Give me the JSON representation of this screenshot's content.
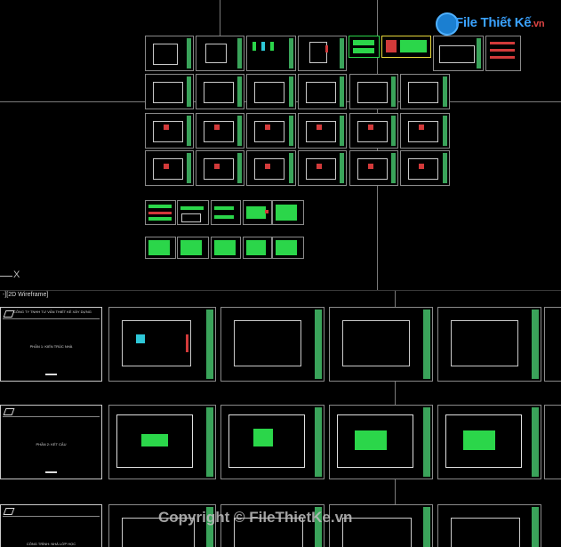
{
  "viewport_label": "-][2D Wireframe]",
  "ucs_axis_label": "X",
  "logo": {
    "brand": "File Thiết Kế",
    "suffix": ".vn"
  },
  "watermark": "Copyright © FileThietKe.vn",
  "cover_sheets": [
    {
      "header": "CÔNG TY TNHH TƯ VẤN THIẾT KẾ XÂY DỰNG",
      "center": "PHẦN 1: KIẾN TRÚC NHÀ"
    },
    {
      "header": "",
      "center": "PHẦN 2: KẾT CẤU"
    },
    {
      "header": "",
      "center": "CÔNG TRÌNH: NHÀ LỚP HỌC"
    }
  ],
  "colors": {
    "background": "#000000",
    "titleblock": "#3aa35a",
    "crosshair": "#7a7a7a"
  }
}
